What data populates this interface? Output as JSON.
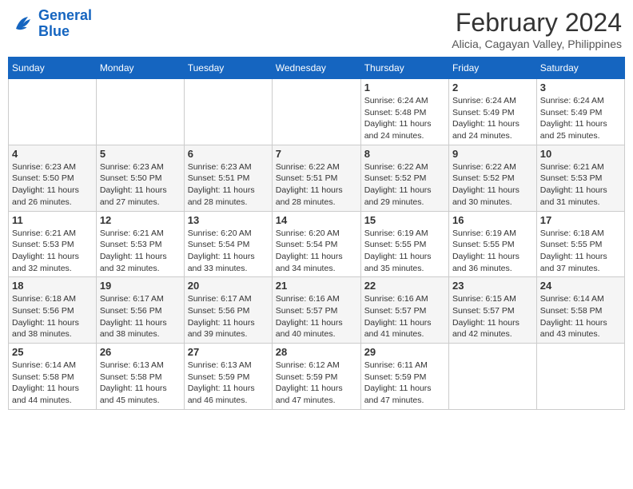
{
  "header": {
    "logo_line1": "General",
    "logo_line2": "Blue",
    "main_title": "February 2024",
    "subtitle": "Alicia, Cagayan Valley, Philippines"
  },
  "weekdays": [
    "Sunday",
    "Monday",
    "Tuesday",
    "Wednesday",
    "Thursday",
    "Friday",
    "Saturday"
  ],
  "weeks": [
    [
      {
        "day": "",
        "info": ""
      },
      {
        "day": "",
        "info": ""
      },
      {
        "day": "",
        "info": ""
      },
      {
        "day": "",
        "info": ""
      },
      {
        "day": "1",
        "info": "Sunrise: 6:24 AM\nSunset: 5:48 PM\nDaylight: 11 hours and 24 minutes."
      },
      {
        "day": "2",
        "info": "Sunrise: 6:24 AM\nSunset: 5:49 PM\nDaylight: 11 hours and 24 minutes."
      },
      {
        "day": "3",
        "info": "Sunrise: 6:24 AM\nSunset: 5:49 PM\nDaylight: 11 hours and 25 minutes."
      }
    ],
    [
      {
        "day": "4",
        "info": "Sunrise: 6:23 AM\nSunset: 5:50 PM\nDaylight: 11 hours and 26 minutes."
      },
      {
        "day": "5",
        "info": "Sunrise: 6:23 AM\nSunset: 5:50 PM\nDaylight: 11 hours and 27 minutes."
      },
      {
        "day": "6",
        "info": "Sunrise: 6:23 AM\nSunset: 5:51 PM\nDaylight: 11 hours and 28 minutes."
      },
      {
        "day": "7",
        "info": "Sunrise: 6:22 AM\nSunset: 5:51 PM\nDaylight: 11 hours and 28 minutes."
      },
      {
        "day": "8",
        "info": "Sunrise: 6:22 AM\nSunset: 5:52 PM\nDaylight: 11 hours and 29 minutes."
      },
      {
        "day": "9",
        "info": "Sunrise: 6:22 AM\nSunset: 5:52 PM\nDaylight: 11 hours and 30 minutes."
      },
      {
        "day": "10",
        "info": "Sunrise: 6:21 AM\nSunset: 5:53 PM\nDaylight: 11 hours and 31 minutes."
      }
    ],
    [
      {
        "day": "11",
        "info": "Sunrise: 6:21 AM\nSunset: 5:53 PM\nDaylight: 11 hours and 32 minutes."
      },
      {
        "day": "12",
        "info": "Sunrise: 6:21 AM\nSunset: 5:53 PM\nDaylight: 11 hours and 32 minutes."
      },
      {
        "day": "13",
        "info": "Sunrise: 6:20 AM\nSunset: 5:54 PM\nDaylight: 11 hours and 33 minutes."
      },
      {
        "day": "14",
        "info": "Sunrise: 6:20 AM\nSunset: 5:54 PM\nDaylight: 11 hours and 34 minutes."
      },
      {
        "day": "15",
        "info": "Sunrise: 6:19 AM\nSunset: 5:55 PM\nDaylight: 11 hours and 35 minutes."
      },
      {
        "day": "16",
        "info": "Sunrise: 6:19 AM\nSunset: 5:55 PM\nDaylight: 11 hours and 36 minutes."
      },
      {
        "day": "17",
        "info": "Sunrise: 6:18 AM\nSunset: 5:55 PM\nDaylight: 11 hours and 37 minutes."
      }
    ],
    [
      {
        "day": "18",
        "info": "Sunrise: 6:18 AM\nSunset: 5:56 PM\nDaylight: 11 hours and 38 minutes."
      },
      {
        "day": "19",
        "info": "Sunrise: 6:17 AM\nSunset: 5:56 PM\nDaylight: 11 hours and 38 minutes."
      },
      {
        "day": "20",
        "info": "Sunrise: 6:17 AM\nSunset: 5:56 PM\nDaylight: 11 hours and 39 minutes."
      },
      {
        "day": "21",
        "info": "Sunrise: 6:16 AM\nSunset: 5:57 PM\nDaylight: 11 hours and 40 minutes."
      },
      {
        "day": "22",
        "info": "Sunrise: 6:16 AM\nSunset: 5:57 PM\nDaylight: 11 hours and 41 minutes."
      },
      {
        "day": "23",
        "info": "Sunrise: 6:15 AM\nSunset: 5:57 PM\nDaylight: 11 hours and 42 minutes."
      },
      {
        "day": "24",
        "info": "Sunrise: 6:14 AM\nSunset: 5:58 PM\nDaylight: 11 hours and 43 minutes."
      }
    ],
    [
      {
        "day": "25",
        "info": "Sunrise: 6:14 AM\nSunset: 5:58 PM\nDaylight: 11 hours and 44 minutes."
      },
      {
        "day": "26",
        "info": "Sunrise: 6:13 AM\nSunset: 5:58 PM\nDaylight: 11 hours and 45 minutes."
      },
      {
        "day": "27",
        "info": "Sunrise: 6:13 AM\nSunset: 5:59 PM\nDaylight: 11 hours and 46 minutes."
      },
      {
        "day": "28",
        "info": "Sunrise: 6:12 AM\nSunset: 5:59 PM\nDaylight: 11 hours and 47 minutes."
      },
      {
        "day": "29",
        "info": "Sunrise: 6:11 AM\nSunset: 5:59 PM\nDaylight: 11 hours and 47 minutes."
      },
      {
        "day": "",
        "info": ""
      },
      {
        "day": "",
        "info": ""
      }
    ]
  ]
}
